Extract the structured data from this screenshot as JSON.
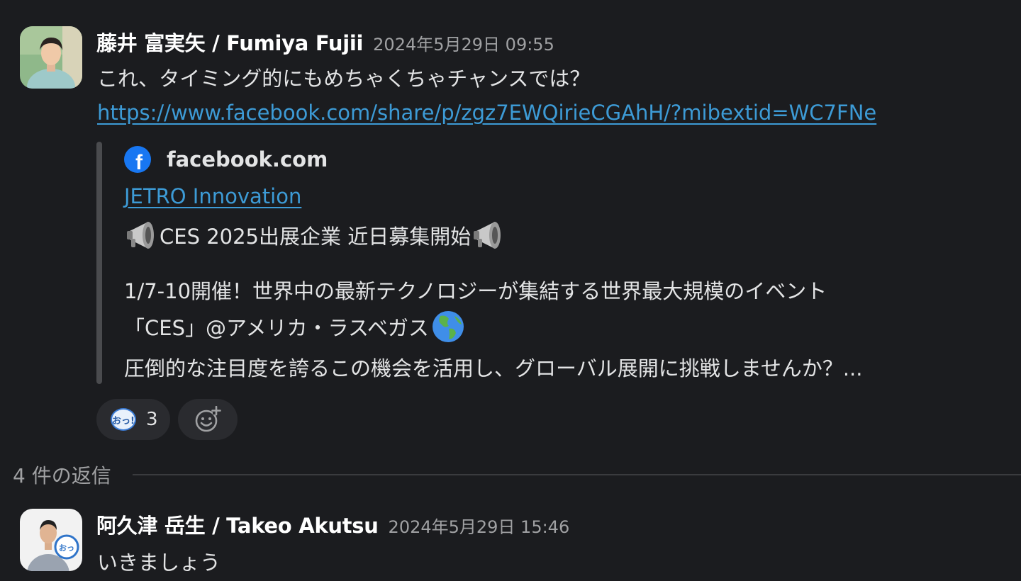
{
  "message": {
    "author": "藤井 富実矢 / Fumiya Fujii",
    "timestamp": "2024年5月29日 09:55",
    "text": "これ、タイミング的にもめちゃくちゃチャンスでは？",
    "link": "https://www.facebook.com/share/p/zgz7EWQirieCGAhH/?mibextid=WC7FNe",
    "unfurl": {
      "site_icon": "facebook-icon",
      "site": "facebook.com",
      "title": "JETRO Innovation",
      "headline": "CES 2025出展企業 近日募集開始",
      "line1": "1/7-10開催！世界中の最新テクノロジーが集結する世界最大規模のイベント",
      "line2": "「CES」@アメリカ・ラスベガス",
      "line3": "圧倒的な注目度を誇るこの機会を活用し、グローバル展開に挑戦しませんか？..."
    },
    "reactions": [
      {
        "emoji": "oh-speech-bubble-emoji",
        "badge_text": "おっ!",
        "count": "3"
      }
    ],
    "add_reaction_icon": "add-reaction-icon"
  },
  "thread": {
    "replies_label": "4 件の返信"
  },
  "reply": {
    "author": "阿久津 岳生 / Takeo Akutsu",
    "timestamp": "2024年5月29日 15:46",
    "text": "いきましょう"
  },
  "colors": {
    "background": "#1b1c1f",
    "link": "#3d9bd6",
    "facebook_blue": "#1877f2"
  }
}
